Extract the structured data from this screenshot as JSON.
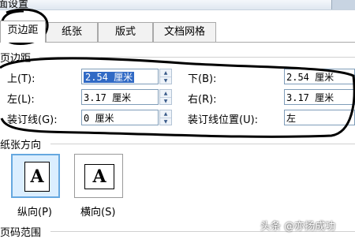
{
  "window": {
    "title": "面设置"
  },
  "tabs": [
    {
      "label": "页边距"
    },
    {
      "label": "纸张"
    },
    {
      "label": "版式"
    },
    {
      "label": "文档网格"
    }
  ],
  "margins": {
    "group_label": "页边距",
    "top_label": "上(T):",
    "top_value": "2.54 厘米",
    "bottom_label": "下(B):",
    "bottom_value": "2.54 厘米",
    "left_label": "左(L):",
    "left_value": "3.17 厘米",
    "right_label": "右(R):",
    "right_value": "3.17 厘米",
    "gutter_label": "装订线(G):",
    "gutter_value": "0 厘米",
    "gutter_pos_label": "装订线位置(U):",
    "gutter_pos_value": "左"
  },
  "orientation": {
    "group_label": "纸张方向",
    "portrait_label": "纵向(P)",
    "landscape_label": "横向(S)",
    "icon_letter": "A",
    "selected": "portrait"
  },
  "pages": {
    "group_label": "页码范围"
  },
  "watermark": "头条 @亦扬成功",
  "colors": {
    "selection": "#316ac5",
    "tab_border": "#a9a9a9",
    "field_border": "#7f9db9"
  }
}
